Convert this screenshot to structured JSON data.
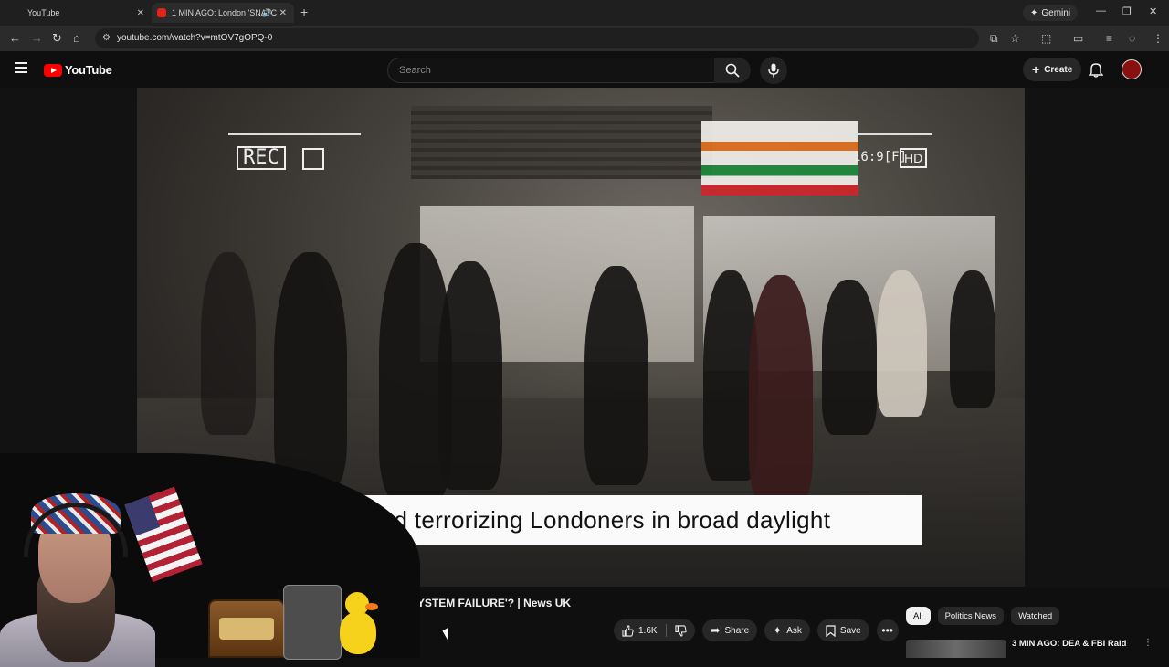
{
  "browser": {
    "tabs": [
      {
        "label": "YouTube"
      },
      {
        "label": "1 MIN AGO: London 'SNATC"
      }
    ],
    "gemini_label": "Gemini",
    "url": "youtube.com/watch?v=mtOV7gOPQ-0"
  },
  "youtube": {
    "logo_text": "YouTube",
    "search_placeholder": "Search",
    "create_label": "Create"
  },
  "video": {
    "hud_rec": "REC",
    "hud_ratio": "16:9[F]",
    "hud_hd": "HD",
    "subtitle": "and terrorizing Londoners in broad daylight"
  },
  "below_video": {
    "title": "'SYSTEM FAILURE'? | News UK",
    "like_count": "1.6K",
    "share_label": "Share",
    "ask_label": "Ask",
    "save_label": "Save"
  },
  "sidebar": {
    "chips": [
      "All",
      "Politics News",
      "Watched"
    ],
    "active_chip": "All",
    "recommended": [
      {
        "title": "3 MIN AGO: DEA & FBI Raid"
      }
    ]
  },
  "colors": {
    "yt_red": "#ff0000",
    "bg": "#0f0f0f",
    "chip_bg": "#272727"
  }
}
